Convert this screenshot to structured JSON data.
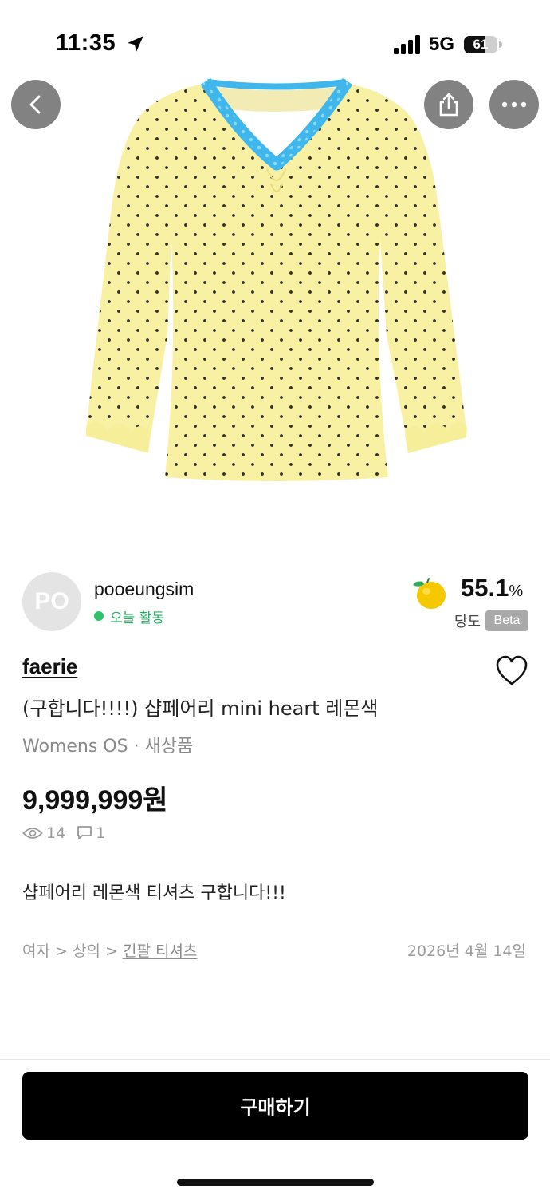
{
  "status_bar": {
    "time": "11:35",
    "network": "5G",
    "battery": "61",
    "battery_level": 0.61
  },
  "seller": {
    "avatar_initials": "PO",
    "name": "pooeungsim",
    "activity": "오늘 활동",
    "sweetness_value": "55.1",
    "sweetness_unit": "%",
    "sweetness_label": "당도",
    "beta_badge": "Beta"
  },
  "product": {
    "brand": "faerie",
    "title": "(구합니다!!!!) 샵페어리 mini heart 레몬색",
    "category_line": "Womens OS · 새상품",
    "price": "9,999,999원",
    "views": "14",
    "comments": "1",
    "description": "샵페어리 레몬색 티셔츠 구합니다!!!",
    "breadcrumb": {
      "level1": "여자",
      "separator": ">",
      "level2": "상의",
      "level3": "긴팔 티셔츠"
    },
    "date": "2026년 4월 14일"
  },
  "actions": {
    "buy_label": "구매하기"
  },
  "colors": {
    "shirt_yellow": "#f8f1a3",
    "lace_blue": "#3fb6ec",
    "dot_color": "#2c2c2c",
    "active_green": "#2ec26a",
    "buy_button": "#000000",
    "lemon": "#f6c800"
  },
  "icons": {
    "back": "chevron-left-icon",
    "share": "share-icon",
    "more": "more-horizontal-icon",
    "like": "heart-outline-icon",
    "views": "eye-icon",
    "comments": "chat-bubble-icon",
    "sweetness": "lemon-icon"
  }
}
